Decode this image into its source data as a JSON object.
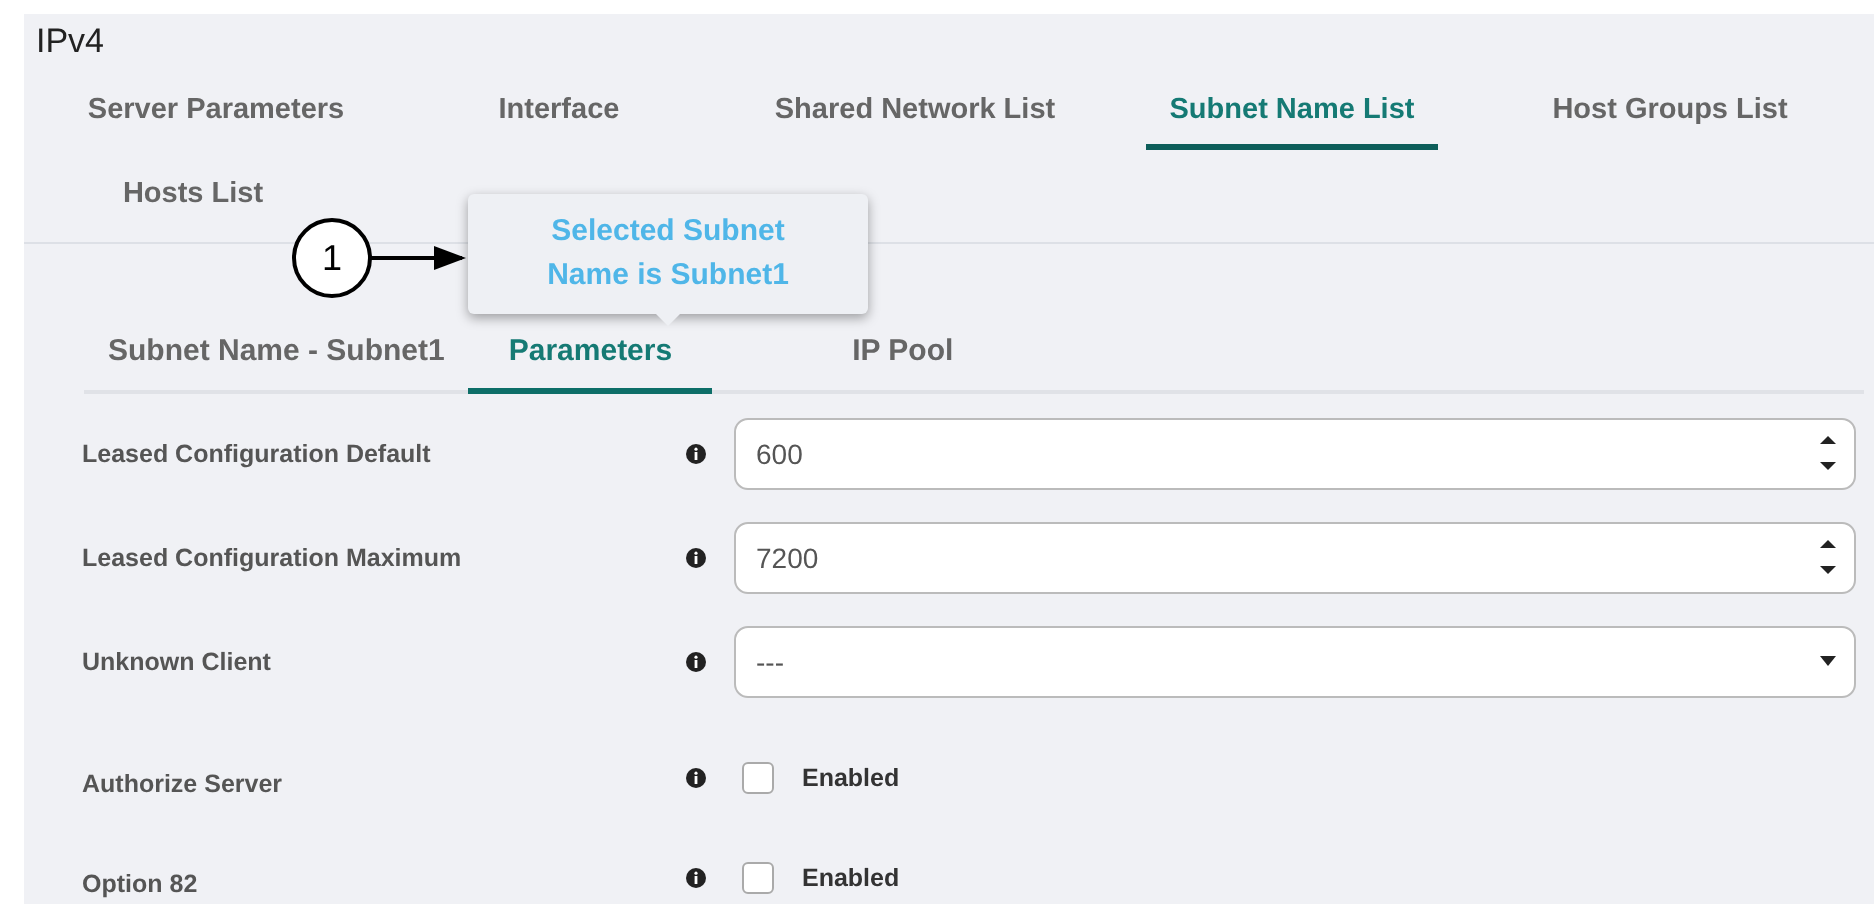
{
  "title": "IPv4",
  "tabs": [
    {
      "label": "Server Parameters",
      "selected": false
    },
    {
      "label": "Interface",
      "selected": false
    },
    {
      "label": "Shared Network List",
      "selected": false
    },
    {
      "label": "Subnet Name List",
      "selected": true
    },
    {
      "label": "Host Groups List",
      "selected": false
    },
    {
      "label": "Hosts List",
      "selected": false
    }
  ],
  "subtabs": [
    {
      "label": "Subnet Name - Subnet1",
      "selected": false
    },
    {
      "label": "Parameters",
      "selected": true
    },
    {
      "label": "IP Pool",
      "selected": false
    }
  ],
  "tooltip": "Selected Subnet Name is Subnet1",
  "callout": "1",
  "fields": [
    {
      "kind": "number",
      "label": "Leased Configuration Default",
      "value": "600"
    },
    {
      "kind": "number",
      "label": "Leased Configuration Maximum",
      "value": "7200"
    },
    {
      "kind": "select",
      "label": "Unknown Client",
      "value": "---"
    },
    {
      "kind": "checkbox",
      "label": "Authorize Server",
      "option": "Enabled",
      "checked": false
    },
    {
      "kind": "checkbox",
      "label": "Option 82",
      "option": "Enabled",
      "checked": false
    }
  ]
}
